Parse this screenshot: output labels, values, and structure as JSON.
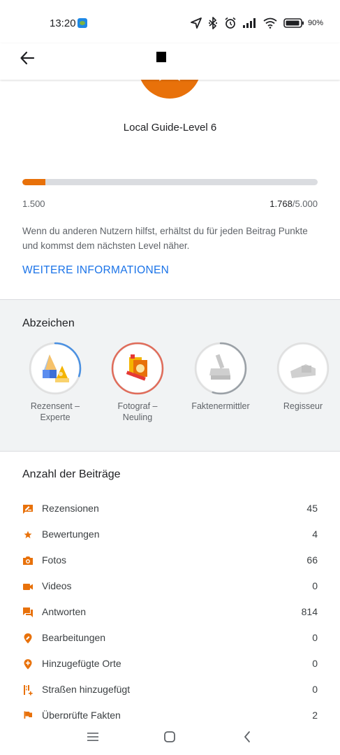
{
  "status_bar": {
    "time": "13:20",
    "battery_percent": "90%",
    "icons": [
      "navigation-icon",
      "bluetooth-icon",
      "alarm-icon",
      "signal-icon",
      "wifi-icon",
      "battery-icon"
    ]
  },
  "toolbar": {
    "back_icon": "arrow-back-icon",
    "title_glyph": "■"
  },
  "level": {
    "title": "Local Guide-Level 6",
    "progress_min": "1.500",
    "current_points": "1.768",
    "target_points": "/5.000",
    "progress_fraction": 0.078
  },
  "info": {
    "text": "Wenn du anderen Nutzern hilfst, erhältst du für jeden Beitrag Punkte und kommst dem nächsten Level näher.",
    "link": "WEITERE INFORMATIONEN"
  },
  "badges": {
    "title": "Abzeichen",
    "items": [
      {
        "line1": "Rezensent –",
        "line2": "Experte",
        "icon": "reviewer-badge-icon",
        "progress": 0.3,
        "ring_color": "#4a90e2"
      },
      {
        "line1": "Fotograf –",
        "line2": "Neuling",
        "icon": "photographer-badge-icon",
        "progress": 1.0,
        "ring_color": "#e06c5a"
      },
      {
        "line1": "Faktenermittler",
        "line2": "",
        "icon": "fact-checker-badge-icon",
        "progress": 0.55,
        "ring_color": "#9aa0a6"
      },
      {
        "line1": "Regisseur",
        "line2": "",
        "icon": "director-badge-icon",
        "progress": 0.0,
        "ring_color": "#9aa0a6"
      }
    ]
  },
  "contributions": {
    "title": "Anzahl der Beiträge",
    "accent_color": "#e8710a",
    "rows": [
      {
        "label": "Rezensionen",
        "count": "45",
        "icon": "review-icon"
      },
      {
        "label": "Bewertungen",
        "count": "4",
        "icon": "star-icon"
      },
      {
        "label": "Fotos",
        "count": "66",
        "icon": "camera-icon"
      },
      {
        "label": "Videos",
        "count": "0",
        "icon": "videocam-icon"
      },
      {
        "label": "Antworten",
        "count": "814",
        "icon": "answers-icon"
      },
      {
        "label": "Bearbeitungen",
        "count": "0",
        "icon": "edit-location-icon"
      },
      {
        "label": "Hinzugefügte Orte",
        "count": "0",
        "icon": "add-location-icon"
      },
      {
        "label": "Straßen hinzugefügt",
        "count": "0",
        "icon": "add-road-icon"
      },
      {
        "label": "Überprüfte Fakten",
        "count": "2",
        "icon": "flag-icon"
      }
    ]
  },
  "nav_bar": {
    "buttons": [
      "menu-icon",
      "home-icon",
      "back-icon"
    ]
  }
}
